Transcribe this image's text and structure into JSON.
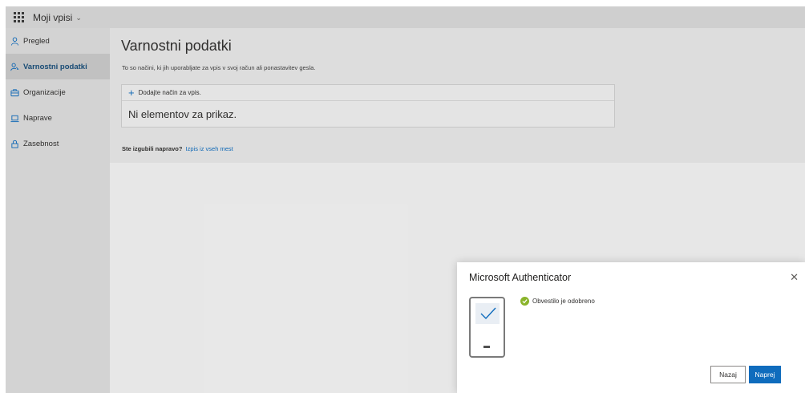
{
  "header": {
    "app_title": "Moji vpisi",
    "chevron_icon": "chevron-down-icon",
    "menu_icon": "waffle-icon"
  },
  "sidebar": {
    "items": [
      {
        "label": "Pregled",
        "icon": "person-icon",
        "active": false
      },
      {
        "label": "Varnostni podatki",
        "icon": "key-person-icon",
        "active": true
      },
      {
        "label": "Organizacije",
        "icon": "briefcase-icon",
        "active": false
      },
      {
        "label": "Naprave",
        "icon": "laptop-icon",
        "active": false
      },
      {
        "label": "Zasebnost",
        "icon": "lock-icon",
        "active": false
      }
    ]
  },
  "main": {
    "title": "Varnostni podatki",
    "subtitle": "To so načini, ki jih uporabljate za vpis v svoj račun ali ponastavitev gesla.",
    "add_method": "Dodajte način za vpis.",
    "empty_text": "Ni elementov za prikaz.",
    "lost_question": "Ste izgubili napravo?",
    "lost_link": "Izpis iz vseh mest"
  },
  "dialog": {
    "title": "Microsoft Authenticator",
    "status_text": "Obvestilo je odobreno",
    "back_label": "Nazaj",
    "next_label": "Naprej"
  },
  "colors": {
    "accent": "#0f6cbd",
    "success": "#8ab42b",
    "sidebar_bg": "#dcdcdc",
    "topbar_bg": "#d8d8d8"
  }
}
